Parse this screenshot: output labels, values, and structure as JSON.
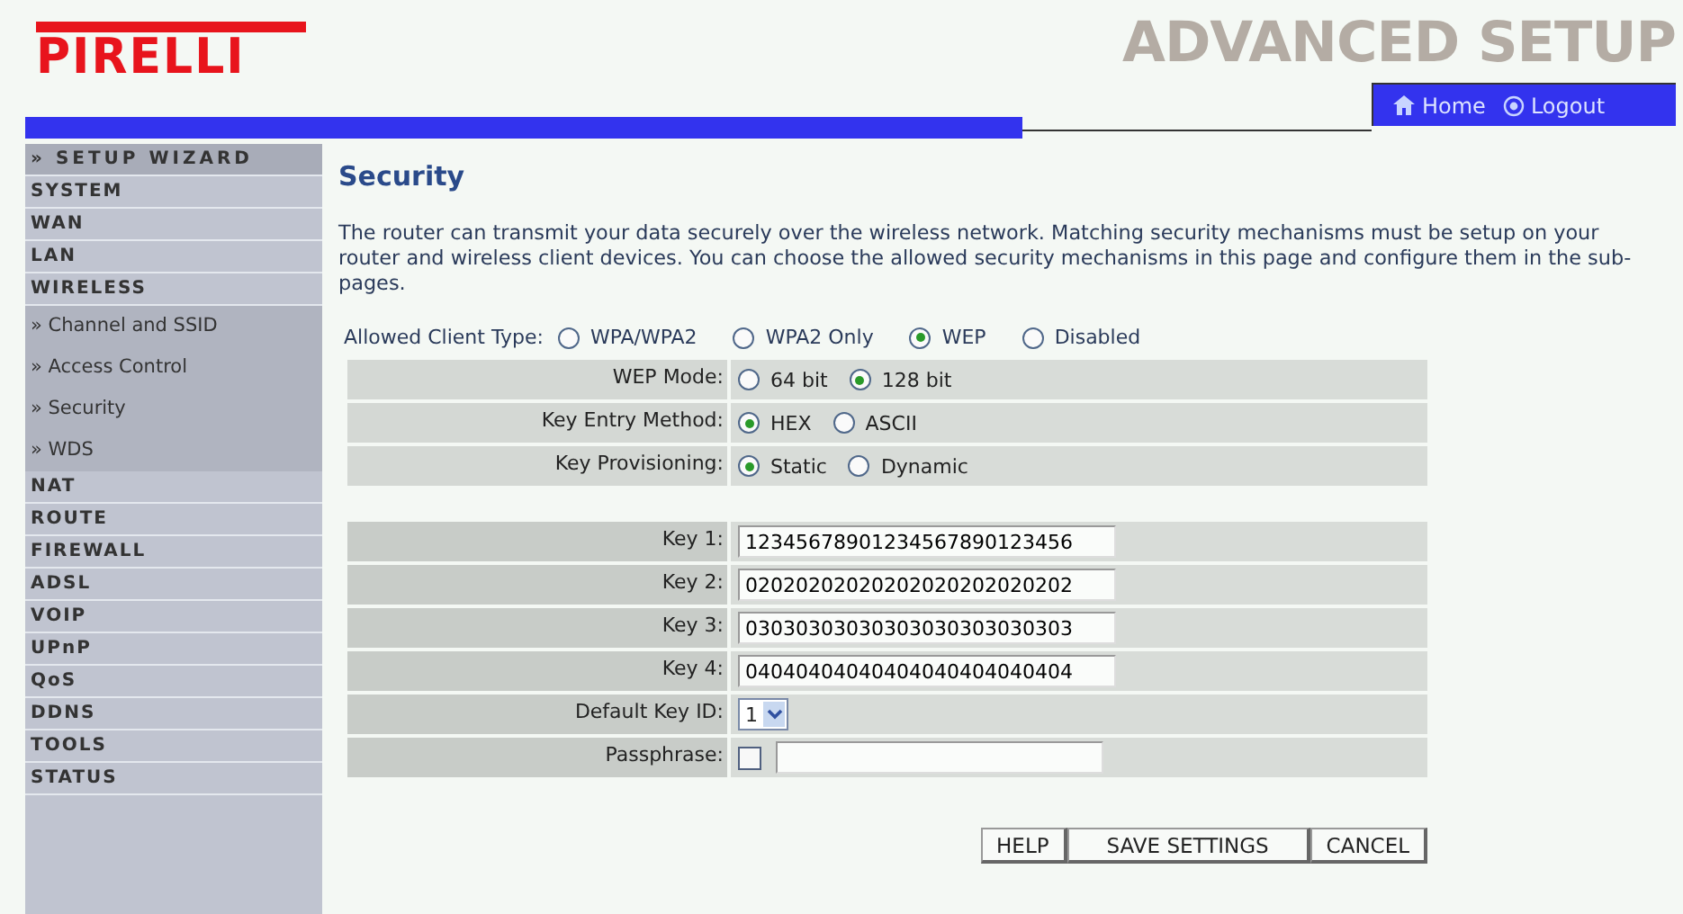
{
  "header": {
    "logo": "PIRELLI",
    "banner": "ADVANCED SETUP",
    "links": [
      {
        "kind": "home",
        "label": "Home"
      },
      {
        "kind": "logout",
        "label": "Logout"
      }
    ]
  },
  "sidebar": {
    "items": [
      {
        "kind": "top",
        "label": "» SETUP WIZARD"
      },
      {
        "kind": "section",
        "label": "SYSTEM"
      },
      {
        "kind": "section",
        "label": "WAN"
      },
      {
        "kind": "section",
        "label": "LAN"
      },
      {
        "kind": "section",
        "label": "WIRELESS"
      },
      {
        "kind": "sub",
        "label": "» Channel and SSID"
      },
      {
        "kind": "sub",
        "label": "» Access Control"
      },
      {
        "kind": "sub",
        "label": "» Security"
      },
      {
        "kind": "sub",
        "label": "» WDS"
      },
      {
        "kind": "section",
        "label": "NAT"
      },
      {
        "kind": "section",
        "label": "ROUTE"
      },
      {
        "kind": "section",
        "label": "FIREWALL"
      },
      {
        "kind": "section",
        "label": "ADSL"
      },
      {
        "kind": "section",
        "label": "VOIP"
      },
      {
        "kind": "section",
        "label": "UPnP"
      },
      {
        "kind": "section",
        "label": "QoS"
      },
      {
        "kind": "section",
        "label": "DDNS"
      },
      {
        "kind": "section",
        "label": "TOOLS"
      },
      {
        "kind": "section",
        "label": "STATUS"
      }
    ]
  },
  "page": {
    "title": "Security",
    "description": "The router can transmit your data securely over the wireless network. Matching security mechanisms must be setup on your router and wireless client devices. You can choose the allowed security mechanisms in this page and configure them in the sub-pages.",
    "client_type": {
      "label": "Allowed Client Type:",
      "options": [
        {
          "label": "WPA/WPA2",
          "selected": false
        },
        {
          "label": "WPA2 Only",
          "selected": false
        },
        {
          "label": "WEP",
          "selected": true
        },
        {
          "label": "Disabled",
          "selected": false
        }
      ]
    },
    "radio_rows": [
      {
        "label": "WEP Mode:",
        "options": [
          {
            "label": "64 bit",
            "selected": false
          },
          {
            "label": "128 bit",
            "selected": true
          }
        ]
      },
      {
        "label": "Key Entry Method:",
        "options": [
          {
            "label": "HEX",
            "selected": true
          },
          {
            "label": "ASCII",
            "selected": false
          }
        ]
      },
      {
        "label": "Key Provisioning:",
        "options": [
          {
            "label": "Static",
            "selected": true
          },
          {
            "label": "Dynamic",
            "selected": false
          }
        ]
      }
    ],
    "key_rows": [
      {
        "label": "Key 1:",
        "value": "12345678901234567890123456"
      },
      {
        "label": "Key 2:",
        "value": "02020202020202020202020202"
      },
      {
        "label": "Key 3:",
        "value": "03030303030303030303030303"
      },
      {
        "label": "Key 4:",
        "value": "04040404040404040404040404"
      }
    ],
    "default_key": {
      "label": "Default Key ID:",
      "value": "1"
    },
    "passphrase": {
      "label": "Passphrase:",
      "checked": false
    },
    "buttons": [
      "HELP",
      "SAVE SETTINGS",
      "CANCEL"
    ]
  }
}
